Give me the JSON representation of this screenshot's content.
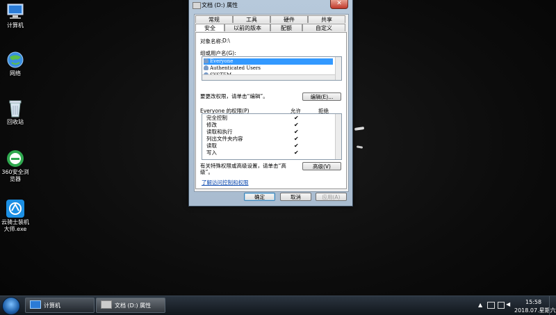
{
  "desktop": {
    "icons": [
      {
        "label": "计算机",
        "icon": "computer-icon"
      },
      {
        "label": "网络",
        "icon": "network-icon"
      },
      {
        "label": "回收站",
        "icon": "recycle-bin-icon"
      },
      {
        "label": "360安全浏览器",
        "icon": "browser-360-icon"
      },
      {
        "label": "云骑士装机大师.exe",
        "icon": "installer-app-icon"
      }
    ]
  },
  "dialog": {
    "title": "文档 (D:) 属性",
    "close": "✕",
    "tabs_back": [
      "常规",
      "工具",
      "硬件",
      "共享"
    ],
    "tabs_front": [
      "安全",
      "以前的版本",
      "配额",
      "自定义"
    ],
    "object_label": "对象名称:",
    "object_value": "D:\\",
    "group_label": "组或用户名(G):",
    "users": [
      "Everyone",
      "Authenticated Users",
      "SYSTEM"
    ],
    "edit_hint": "要更改权限，请单击“编辑”。",
    "edit_button": "编辑(E)...",
    "perm_header": "Everyone 的权限(P)",
    "allow_header": "允许",
    "deny_header": "拒绝",
    "permissions": [
      {
        "name": "完全控制",
        "allow": "✔",
        "deny": ""
      },
      {
        "name": "修改",
        "allow": "✔",
        "deny": ""
      },
      {
        "name": "读取和执行",
        "allow": "✔",
        "deny": ""
      },
      {
        "name": "列出文件夹内容",
        "allow": "✔",
        "deny": ""
      },
      {
        "name": "读取",
        "allow": "✔",
        "deny": ""
      },
      {
        "name": "写入",
        "allow": "✔",
        "deny": ""
      }
    ],
    "advanced_hint_1": "有关特殊权限或高级设置，请单击“高",
    "advanced_hint_2": "级”。",
    "advanced_button": "高级(V)",
    "learn_link": "了解访问控制和权限",
    "ok": "确定",
    "cancel": "取消",
    "apply": "应用(A)"
  },
  "taskbar": {
    "buttons": [
      {
        "label": "计算机",
        "icon": "computer-icon"
      },
      {
        "label": "文档 (D:) 属性",
        "icon": "drive-icon"
      }
    ],
    "time": "15:58",
    "date": "2018.07.星期六"
  },
  "colors": {
    "selection": "#3399ff",
    "dialog_frame": "#b7c9db",
    "link": "#0645ad"
  }
}
